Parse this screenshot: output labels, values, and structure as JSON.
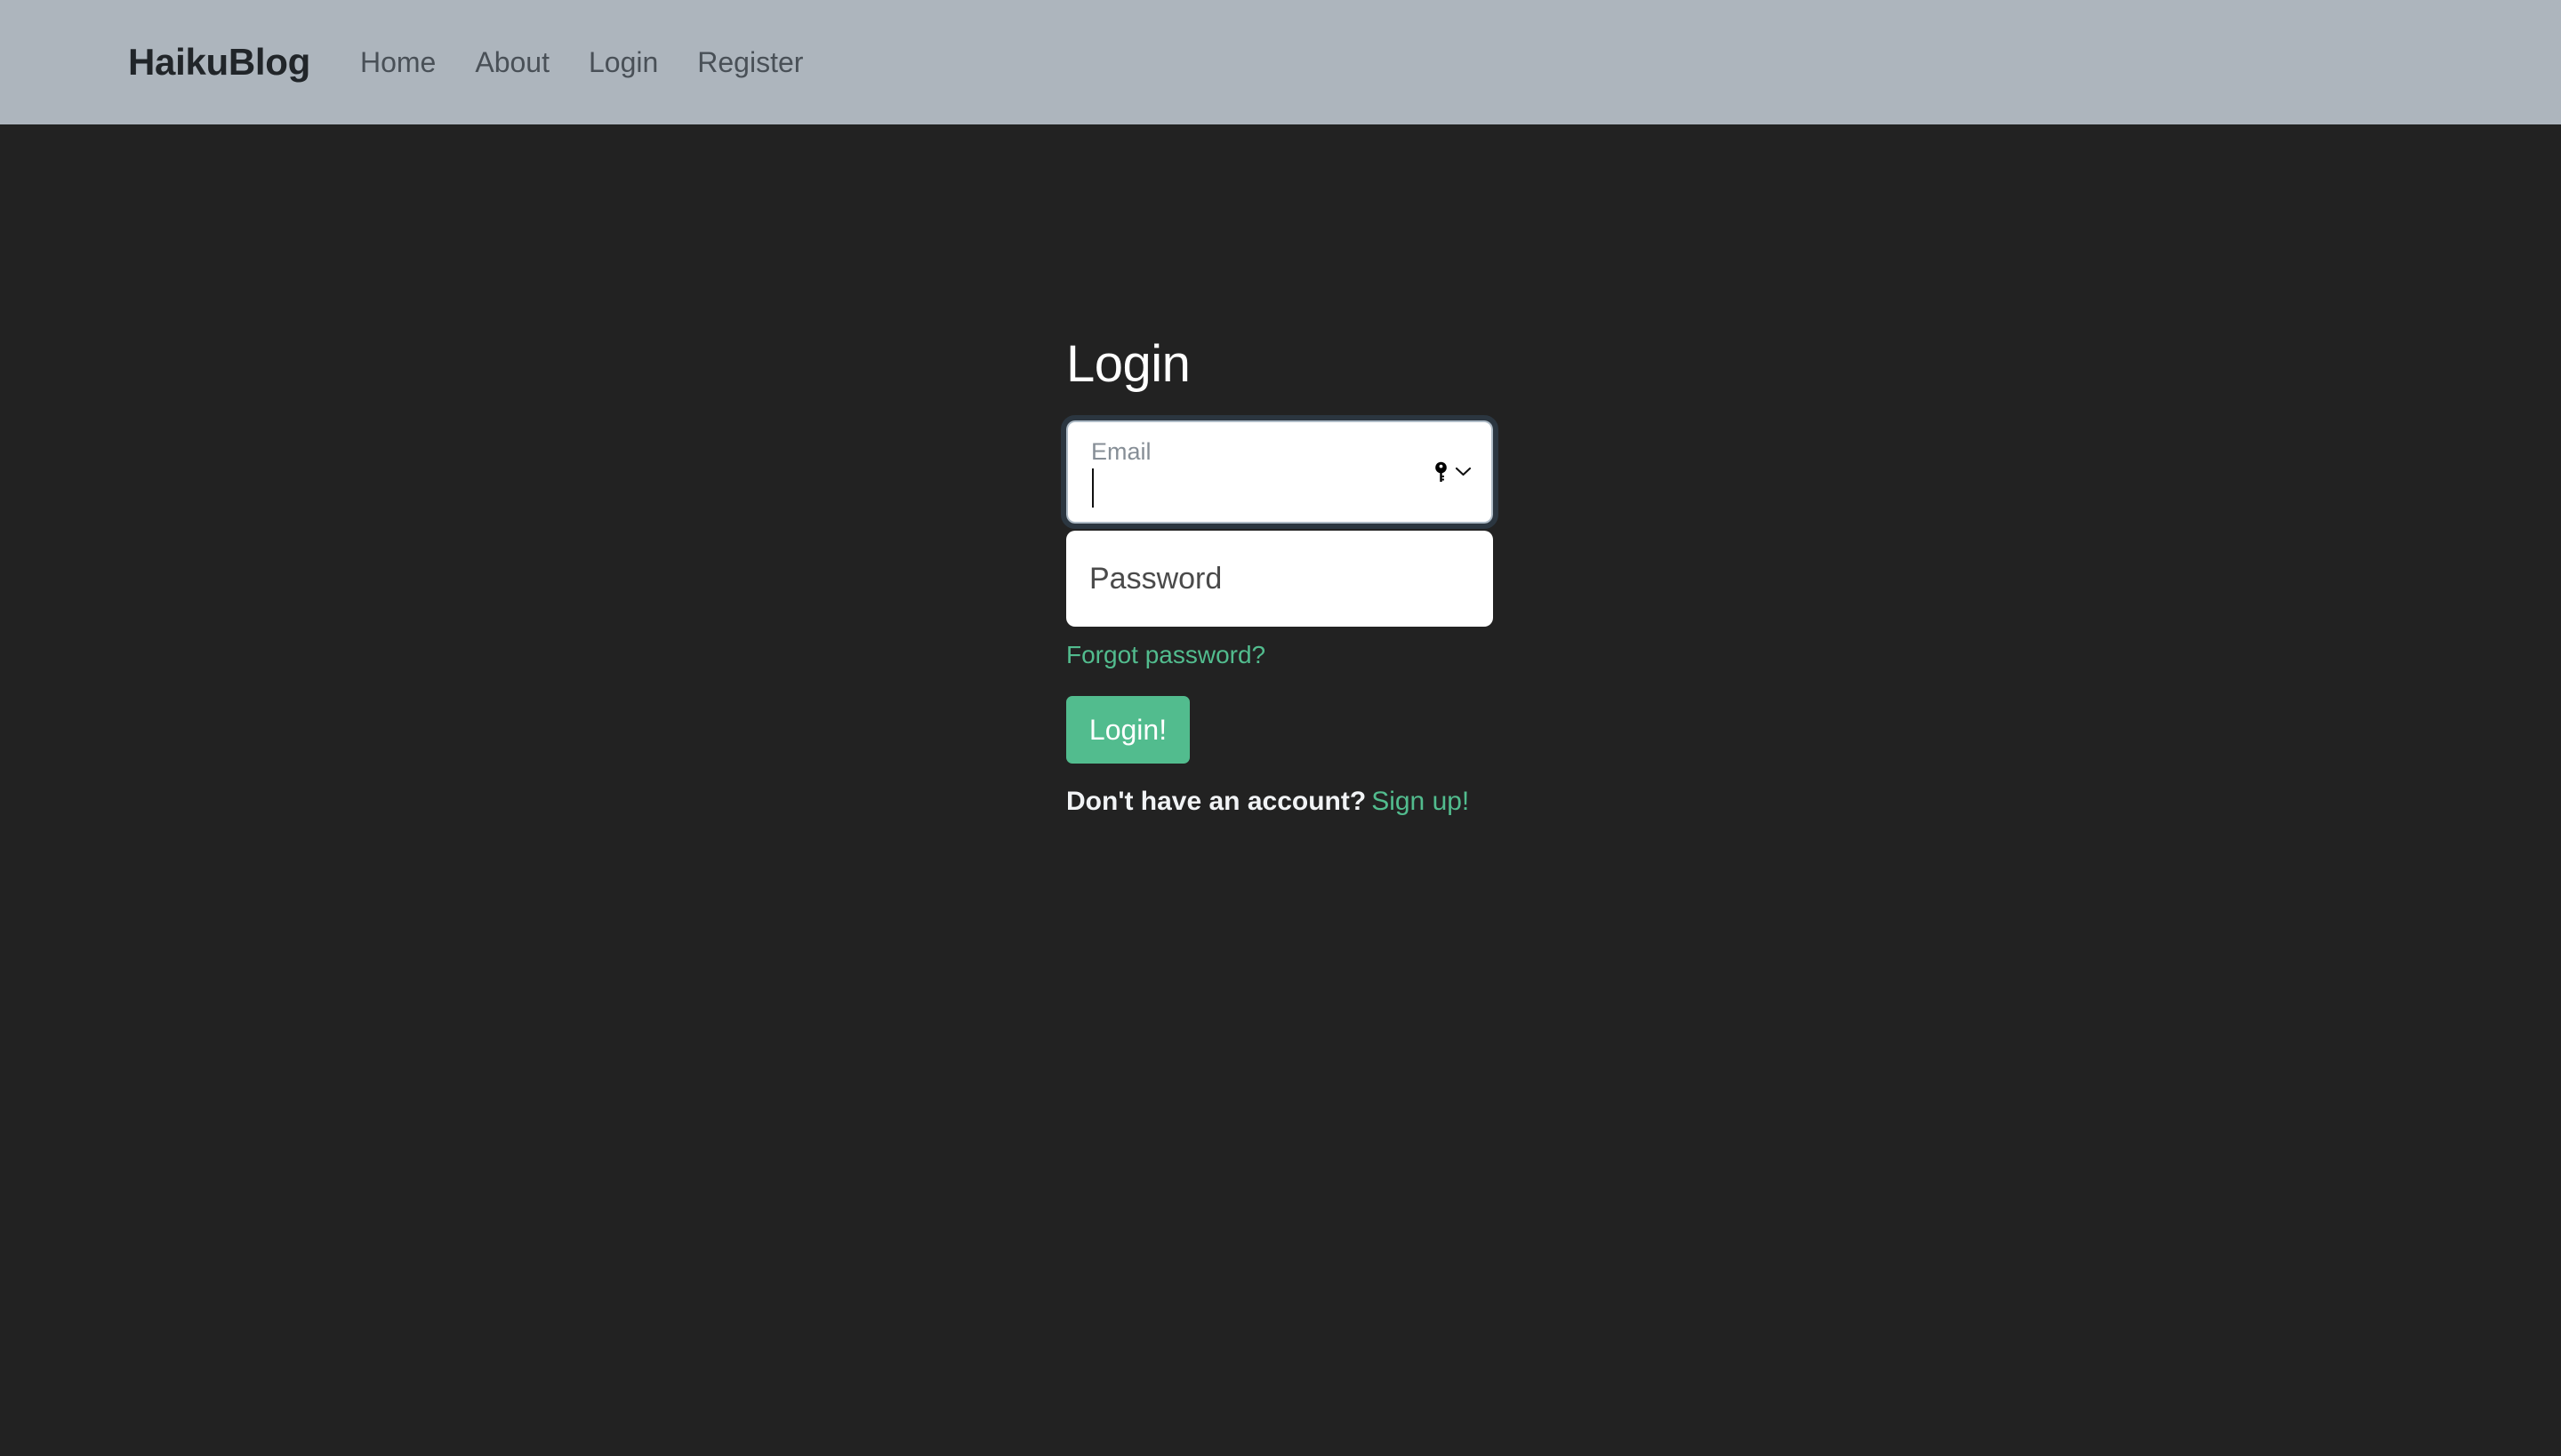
{
  "theme": {
    "page_background": "#222222",
    "navbar_background": "#adb5bd",
    "accent_green": "#52bc8e",
    "brand_text_color": "#212529",
    "nav_link_color": "#495057",
    "input_background": "#ffffff",
    "focus_ring_color": "#2b3640"
  },
  "navbar": {
    "brand": "HaikuBlog",
    "links": [
      {
        "label": "Home"
      },
      {
        "label": "About"
      },
      {
        "label": "Login"
      },
      {
        "label": "Register"
      }
    ]
  },
  "main": {
    "title": "Login",
    "form": {
      "email": {
        "label": "Email",
        "value": "",
        "placeholder": "Email",
        "focused": true,
        "password_manager_icon": "key-icon",
        "password_manager_chevron": "chevron-down-icon"
      },
      "password": {
        "label": "Password",
        "value": "",
        "placeholder": "Password"
      },
      "forgot_password_link": "Forgot password?",
      "submit_button": "Login!",
      "signup_prompt": "Don't have an account?",
      "signup_link": "Sign up!"
    }
  }
}
